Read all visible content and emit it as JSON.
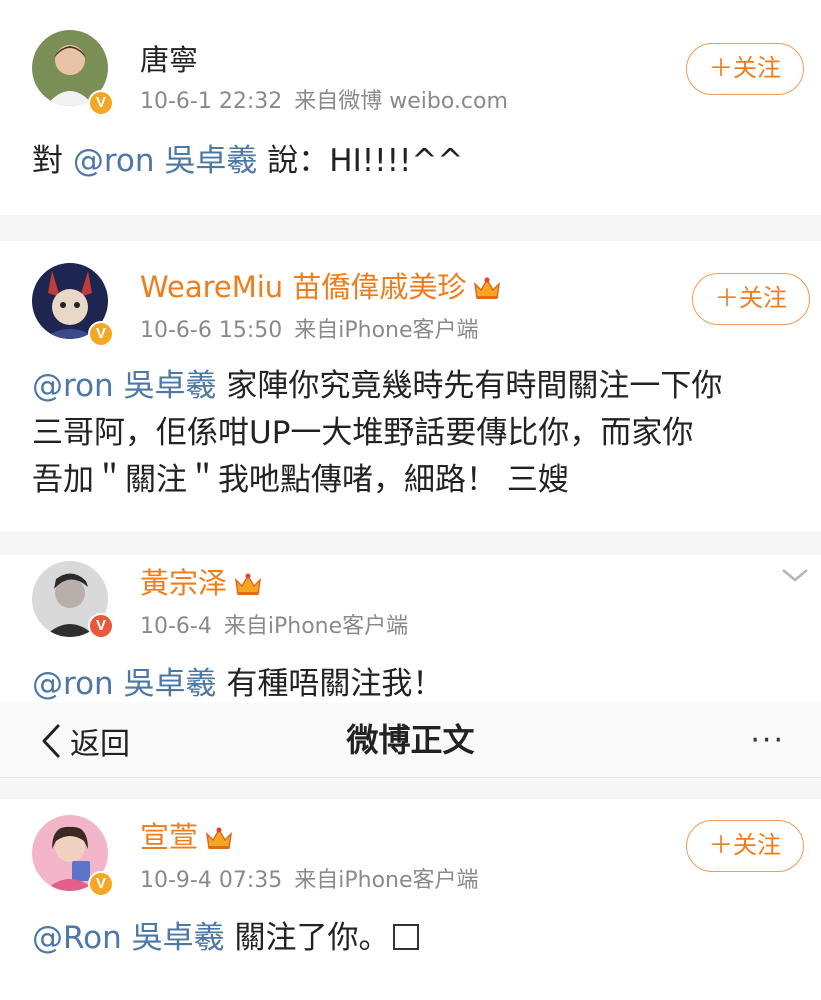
{
  "nav": {
    "back_label": "返回",
    "title": "微博正文",
    "more_label": "···"
  },
  "posts": [
    {
      "author": "唐寧",
      "date": "10-6-1 22:32",
      "source": "来自微博 weibo.com",
      "follow_label": "＋关注",
      "body_prefix": "對 ",
      "mention": "@ron 吳卓羲",
      "body_suffix": " 說：HI!!!!^^"
    },
    {
      "author": "WeareMiu 苗僑偉戚美珍",
      "date": "10-6-6 15:50",
      "source": "来自iPhone客户端",
      "follow_label": "＋关注",
      "mention": "@ron 吳卓羲",
      "line1": " 家陣你究竟幾時先有時間關注一下你",
      "line2": "三哥阿，佢係咁UP一大堆野話要傳比你，而家你",
      "line3": "吾加＂關注＂我吔點傳啫，細路！ 三嫂"
    },
    {
      "author": "黃宗泽",
      "date": "10-6-4",
      "source": "来自iPhone客户端",
      "mention": "@ron 吳卓羲",
      "body_suffix": " 有種唔關注我！"
    },
    {
      "author": "宣萱",
      "date": "10-9-4 07:35",
      "source": "来自iPhone客户端",
      "follow_label": "＋关注",
      "mention": "@Ron 吳卓羲",
      "body_suffix": " 關注了你。"
    }
  ],
  "icons": [
    "verified-badge-icon",
    "vip-crown-icon",
    "chevron-down-icon",
    "back-chevron-icon",
    "more-icon"
  ],
  "colors": {
    "vip_name": "#f07c1a",
    "mention": "#4c77a6",
    "meta": "#8a8a8a",
    "follow_border": "#f39a55",
    "verified_badge": "#f5a623"
  }
}
